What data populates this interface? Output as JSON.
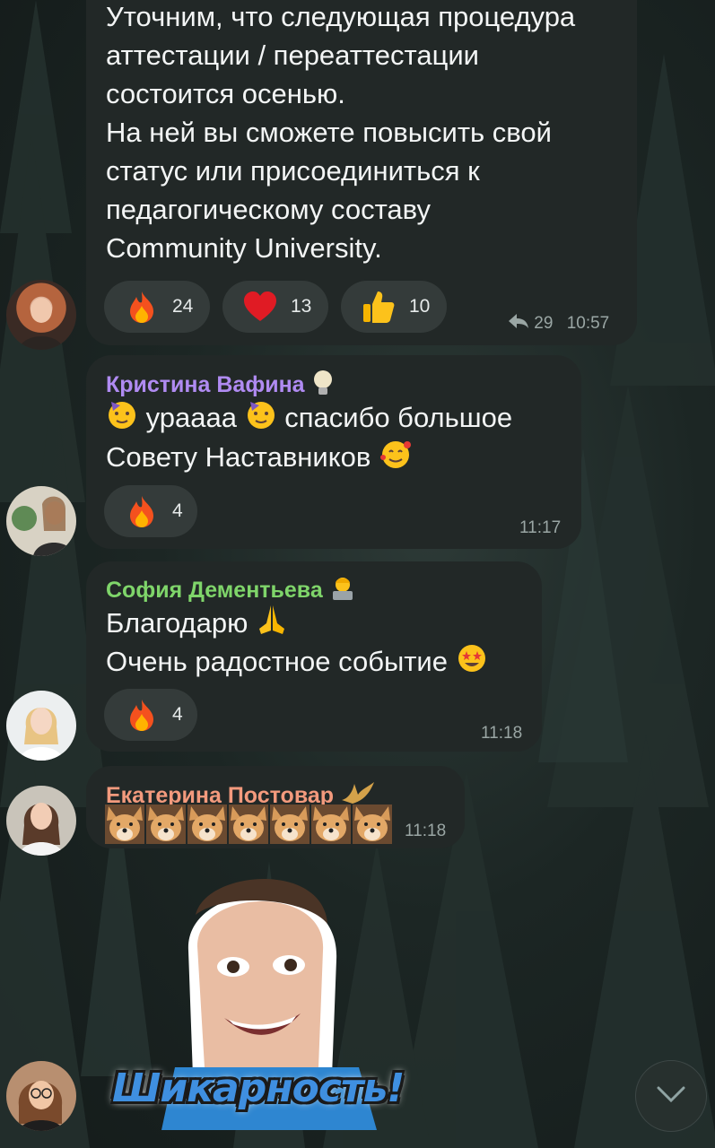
{
  "messages": [
    {
      "id": "msg1",
      "lines": [
        "Уточним, что следующая процедура",
        "аттестации / переаттестации",
        "состоится осенью.",
        "На ней вы сможете повысить свой",
        "статус или присоединиться к",
        "педагогическому составу",
        "Community University."
      ],
      "reactions": [
        {
          "icon": "fire-icon",
          "count": "24"
        },
        {
          "icon": "heart-icon",
          "count": "13"
        },
        {
          "icon": "thumbs-up-icon",
          "count": "10"
        }
      ],
      "replies": "29",
      "time": "10:57"
    },
    {
      "id": "msg2",
      "sender": "Кристина Вафина",
      "sender_color": "#b08bf2",
      "line1_a": "урaaaa",
      "line1_b": "спасибо большое",
      "line2": "Совету Наставников",
      "reactions": [
        {
          "icon": "fire-icon",
          "count": "4"
        }
      ],
      "time": "11:17"
    },
    {
      "id": "msg3",
      "sender": "София Дементьева",
      "sender_color": "#7fd56a",
      "line1": "Благодарю",
      "line2": "Очень радостное событие",
      "reactions": [
        {
          "icon": "fire-icon",
          "count": "4"
        }
      ],
      "time": "11:18"
    },
    {
      "id": "msg4",
      "sender": "Екатерина Постовар",
      "sender_color": "#f39a7d",
      "doge_count": 7,
      "time": "11:18"
    }
  ],
  "sticker": {
    "caption": "Шикарность!"
  },
  "colors": {
    "bubble": "#222827",
    "reaction": "#343b3a",
    "time": "#9aa6a4"
  }
}
